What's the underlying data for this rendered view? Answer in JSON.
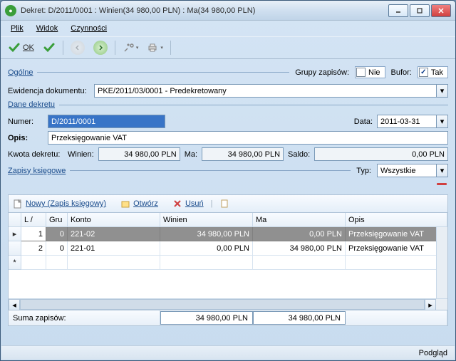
{
  "title": "Dekret: D/2011/0001 : Winien(34 980,00 PLN) : Ma(34 980,00 PLN)",
  "menu": {
    "plik": "Plik",
    "widok": "Widok",
    "czynnosci": "Czynności"
  },
  "toolbar": {
    "ok": "OK"
  },
  "section": {
    "ogolne": "Ogólne",
    "grupy_zapisow": "Grupy zapisów:",
    "nie": "Nie",
    "bufor": "Bufor:",
    "tak": "Tak",
    "ewidencja_label": "Ewidencja dokumentu:",
    "ewidencja_value": "PKE/2011/03/0001 - Predekretowany",
    "dane_dekretu": "Dane dekretu",
    "numer_label": "Numer:",
    "numer_value": "D/2011/0001",
    "data_label": "Data:",
    "data_value": "2011-03-31",
    "opis_label": "Opis:",
    "opis_value": "Przeksięgowanie VAT",
    "kwota_label": "Kwota dekretu:",
    "winien_label": "Winien:",
    "winien_value": "34 980,00 PLN",
    "ma_label": "Ma:",
    "ma_value": "34 980,00 PLN",
    "saldo_label": "Saldo:",
    "saldo_value": "0,00 PLN",
    "zapisy": "Zapisy księgowe",
    "typ_label": "Typ:",
    "typ_value": "Wszystkie"
  },
  "grid_toolbar": {
    "nowy": "Nowy (Zapis księgowy)",
    "otworz": "Otwórz",
    "usun": "Usuń"
  },
  "grid": {
    "h_lp": "L /",
    "h_gru": "Gru",
    "h_konto": "Konto",
    "h_winien": "Winien",
    "h_ma": "Ma",
    "h_opis": "Opis",
    "rows": [
      {
        "lp": "1",
        "gru": "0",
        "konto": "221-02",
        "winien": "34 980,00 PLN",
        "ma": "0,00 PLN",
        "opis": "Przeksięgowanie VAT"
      },
      {
        "lp": "2",
        "gru": "0",
        "konto": "221-01",
        "winien": "0,00 PLN",
        "ma": "34 980,00 PLN",
        "opis": "Przeksięgowanie VAT"
      }
    ],
    "new_marker": "*"
  },
  "footer": {
    "suma": "Suma zapisów:",
    "winien": "34 980,00 PLN",
    "ma": "34 980,00 PLN"
  },
  "status": {
    "podglad": "Podgląd"
  }
}
